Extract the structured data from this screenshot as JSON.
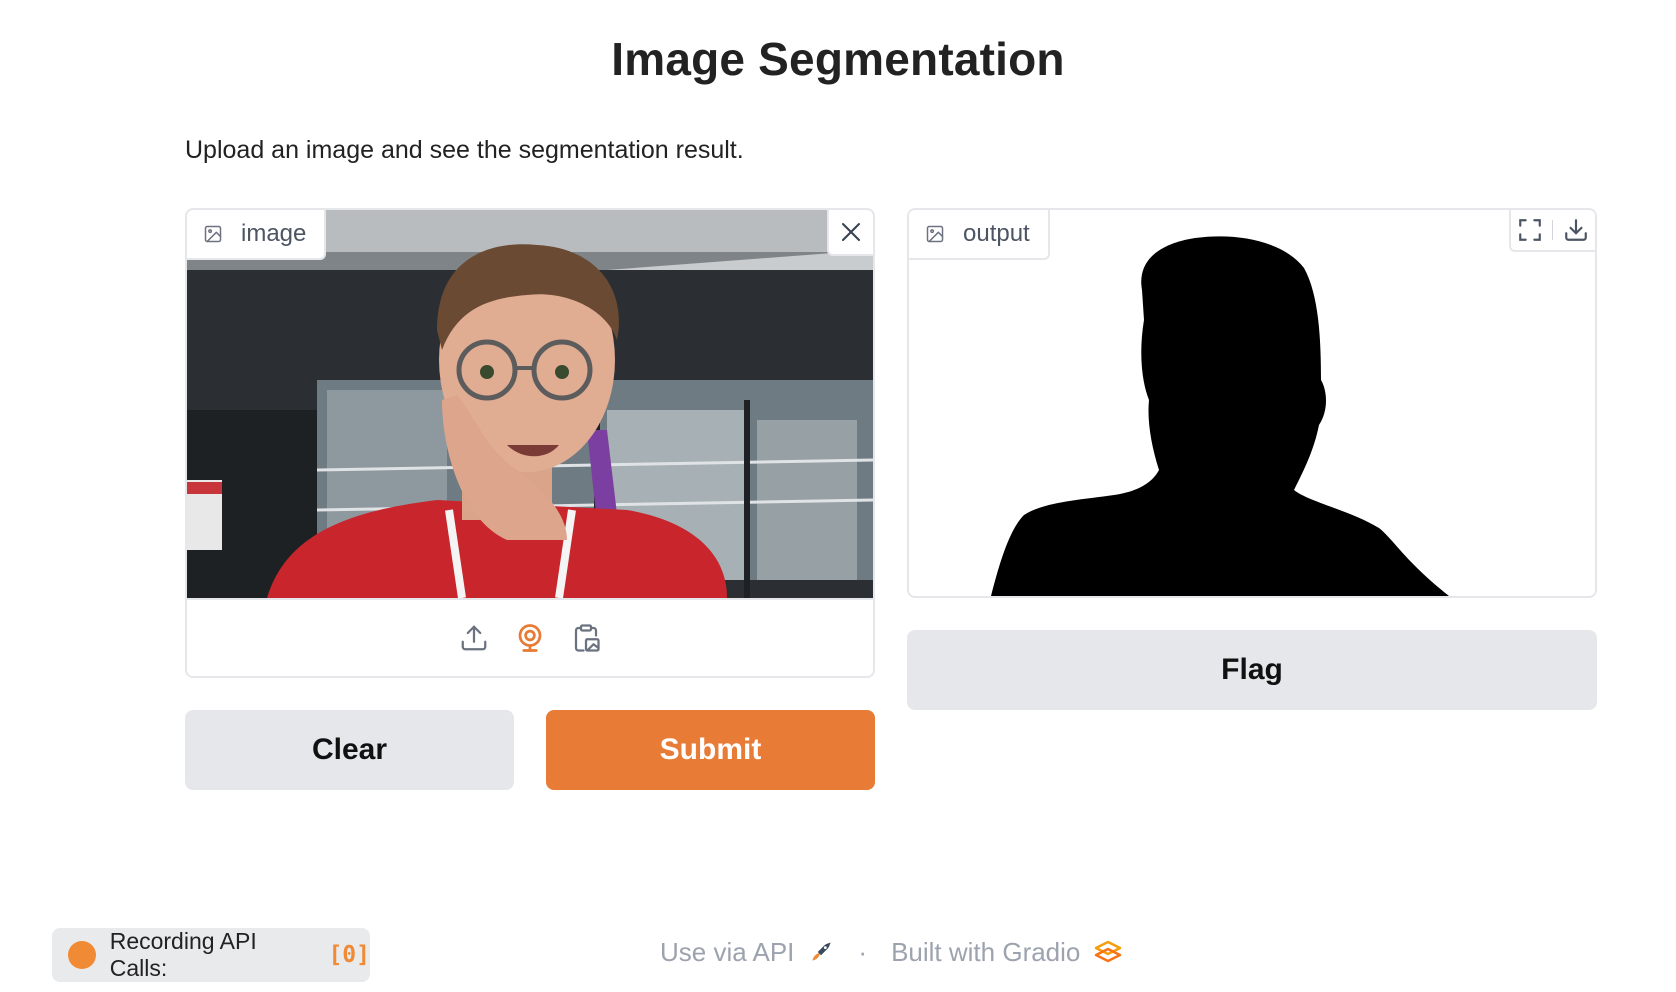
{
  "header": {
    "title": "Image Segmentation",
    "description": "Upload an image and see the segmentation result."
  },
  "input_panel": {
    "label": "image",
    "label_icon": "image-icon",
    "close_icon": "close-icon",
    "sources": [
      {
        "name": "upload-icon"
      },
      {
        "name": "webcam-icon",
        "active": true
      },
      {
        "name": "clipboard-icon"
      }
    ]
  },
  "output_panel": {
    "label": "output",
    "label_icon": "image-icon",
    "tools": [
      "fullscreen-icon",
      "download-icon"
    ]
  },
  "buttons": {
    "clear": "Clear",
    "submit": "Submit",
    "flag": "Flag"
  },
  "footer": {
    "recording_label": "Recording API Calls:",
    "recording_count": "[0]",
    "use_api": "Use via API",
    "separator": "·",
    "built_with": "Built with Gradio"
  },
  "colors": {
    "accent": "#e87b35",
    "button_secondary": "#e5e7eb",
    "border": "#e5e7eb",
    "footer_text": "#9ca3af"
  }
}
